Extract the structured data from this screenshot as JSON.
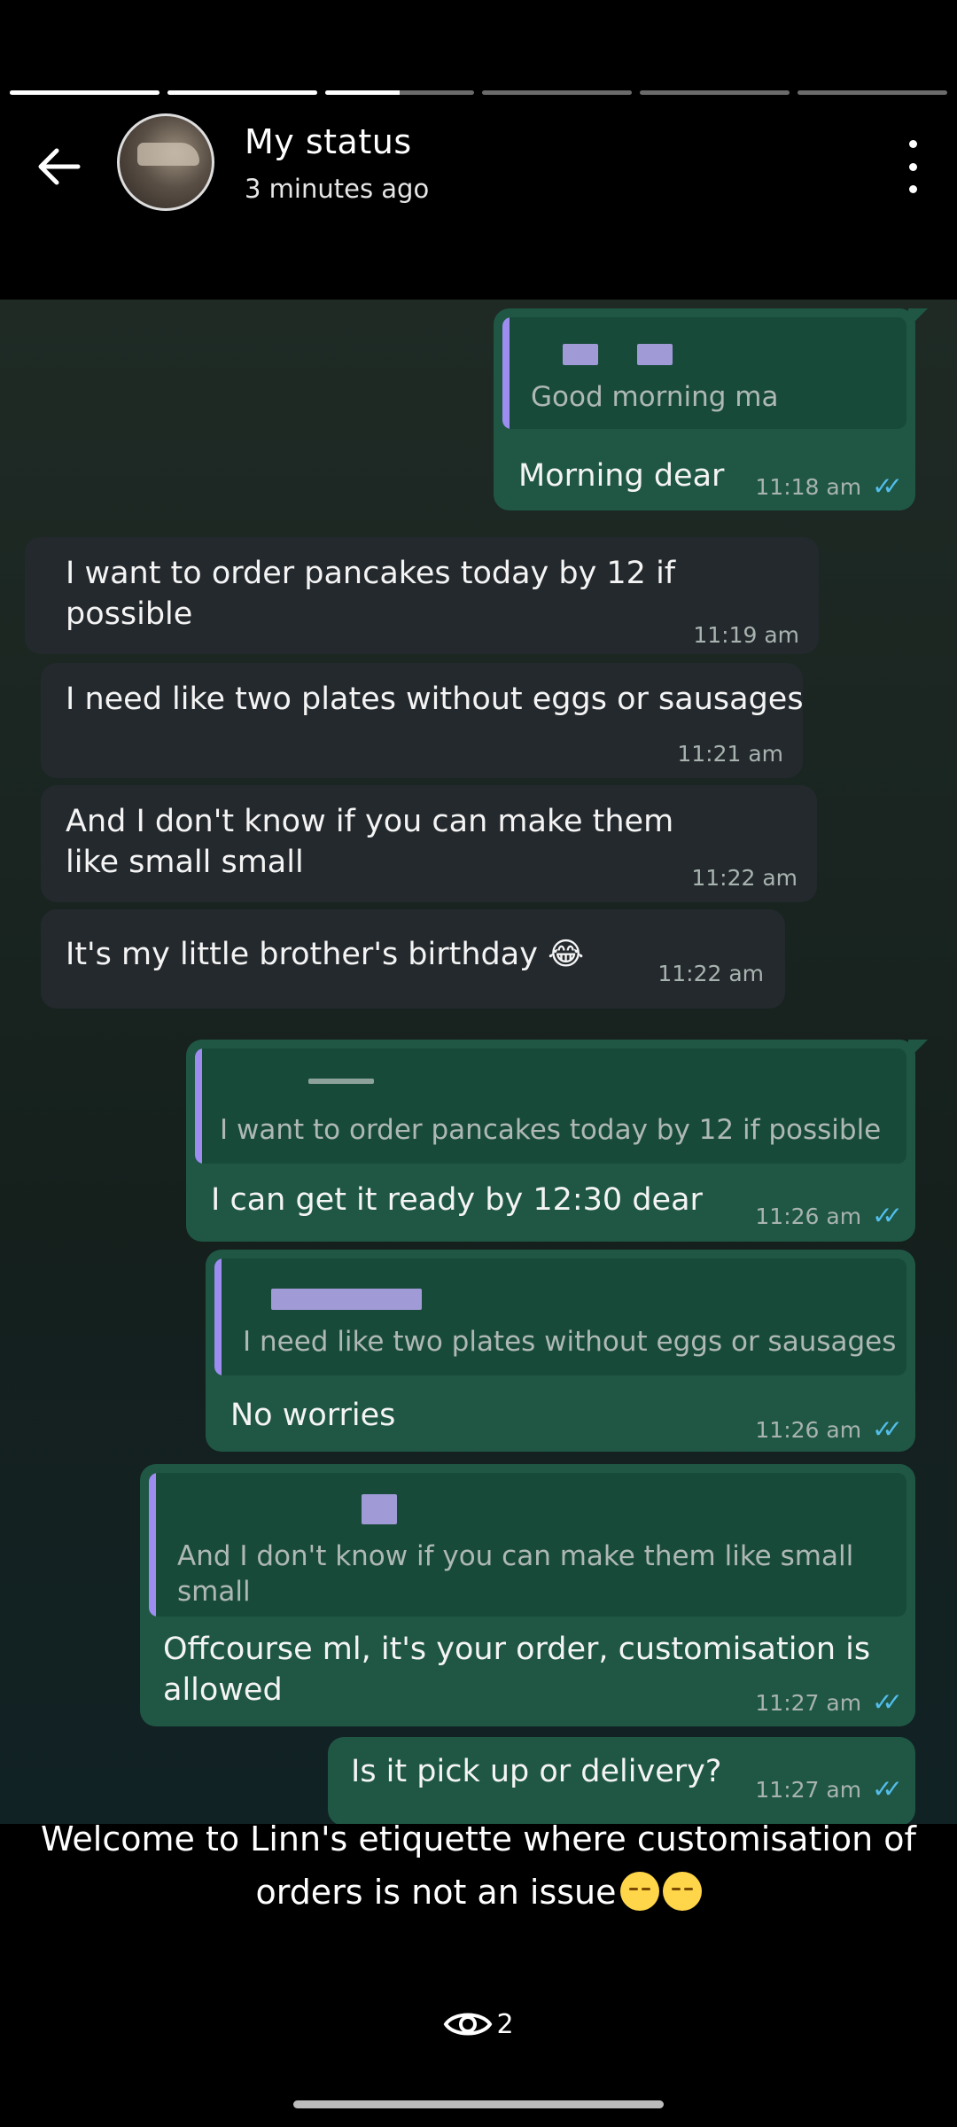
{
  "status": {
    "title": "My status",
    "time_ago": "3 minutes ago",
    "segments": [
      1,
      1,
      0.5,
      0,
      0,
      0
    ],
    "views": "2"
  },
  "chat": {
    "m1": {
      "reply": "Good morning ma",
      "text": "Morning dear",
      "time": "11:18 am"
    },
    "m2": {
      "text": "I want to order pancakes today by 12 if possible",
      "time": "11:19 am"
    },
    "m3": {
      "text": "I need like two plates without eggs or sausages",
      "time": "11:21 am"
    },
    "m4": {
      "text": "And I don't know if you can make them like small small",
      "time": "11:22 am"
    },
    "m5": {
      "text": "It's my little brother's birthday",
      "emoji": "😂",
      "time": "11:22 am"
    },
    "m6": {
      "reply": "I want to order pancakes today by 12 if possible",
      "text": "I can get it ready by 12:30 dear",
      "time": "11:26 am"
    },
    "m7": {
      "reply": "I need like two plates without eggs or sausages",
      "text": "No worries",
      "time": "11:26 am"
    },
    "m8": {
      "reply": "And I don't know if you can make them like small small",
      "text": "Offcourse ml, it's your order, customisation is allowed",
      "time": "11:27 am"
    },
    "m9": {
      "text": "Is it pick up or delivery?",
      "time": "11:27 am"
    }
  },
  "caption": {
    "text": "Welcome to Linn's etiquette where customisation of orders is not an issue"
  },
  "colors": {
    "outgoing": "#1f5744",
    "incoming": "#24292d",
    "quote_bar": "#9e8df0",
    "read_ticks": "#53bdeb"
  }
}
